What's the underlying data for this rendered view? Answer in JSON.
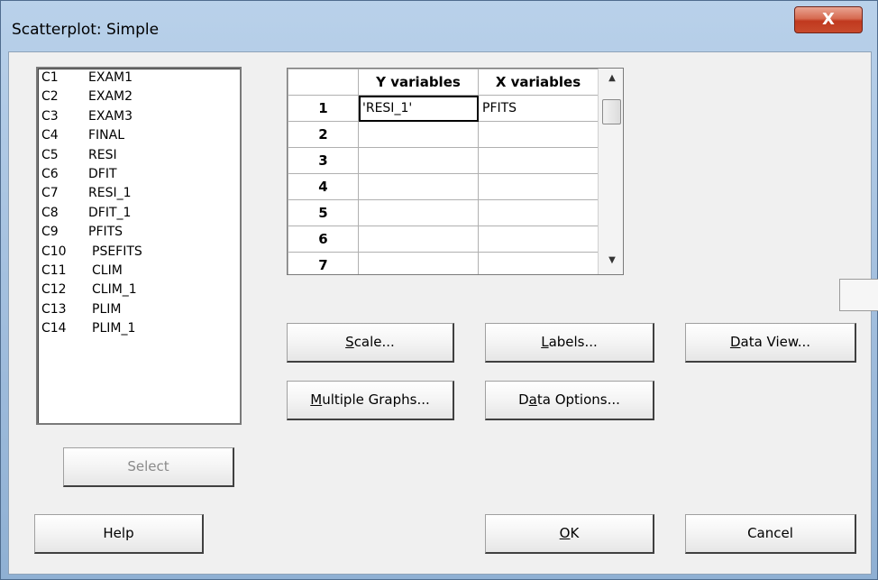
{
  "window": {
    "title": "Scatterplot: Simple",
    "close_label": "X"
  },
  "columns_list": [
    {
      "id": "C1",
      "name": "EXAM1"
    },
    {
      "id": "C2",
      "name": "EXAM2"
    },
    {
      "id": "C3",
      "name": "EXAM3"
    },
    {
      "id": "C4",
      "name": "FINAL"
    },
    {
      "id": "C5",
      "name": "RESI"
    },
    {
      "id": "C6",
      "name": "DFIT"
    },
    {
      "id": "C7",
      "name": "RESI_1"
    },
    {
      "id": "C8",
      "name": "DFIT_1"
    },
    {
      "id": "C9",
      "name": "PFITS"
    },
    {
      "id": "C10",
      "name": "PSEFITS"
    },
    {
      "id": "C11",
      "name": "CLIM"
    },
    {
      "id": "C12",
      "name": "CLIM_1"
    },
    {
      "id": "C13",
      "name": "PLIM"
    },
    {
      "id": "C14",
      "name": "PLIM_1"
    }
  ],
  "grid": {
    "headers": [
      "Y variables",
      "X variables"
    ],
    "rows": [
      {
        "num": "1",
        "y": "'RESI_1'",
        "x": "PFITS"
      },
      {
        "num": "2",
        "y": "",
        "x": ""
      },
      {
        "num": "3",
        "y": "",
        "x": ""
      },
      {
        "num": "4",
        "y": "",
        "x": ""
      },
      {
        "num": "5",
        "y": "",
        "x": ""
      },
      {
        "num": "6",
        "y": "",
        "x": ""
      },
      {
        "num": "7",
        "y": "",
        "x": ""
      }
    ]
  },
  "buttons": {
    "scale": {
      "pre": "",
      "key": "S",
      "post": "cale..."
    },
    "labels": {
      "pre": "",
      "key": "L",
      "post": "abels..."
    },
    "data_view": {
      "pre": "",
      "key": "D",
      "post": "ata View..."
    },
    "multiple_graphs": {
      "pre": "",
      "key": "M",
      "post": "ultiple Graphs..."
    },
    "data_options": {
      "pre": "D",
      "key": "a",
      "post": "ta Options..."
    },
    "select": "Select",
    "help": "Help",
    "ok": {
      "pre": "",
      "key": "O",
      "post": "K"
    },
    "cancel": "Cancel"
  }
}
